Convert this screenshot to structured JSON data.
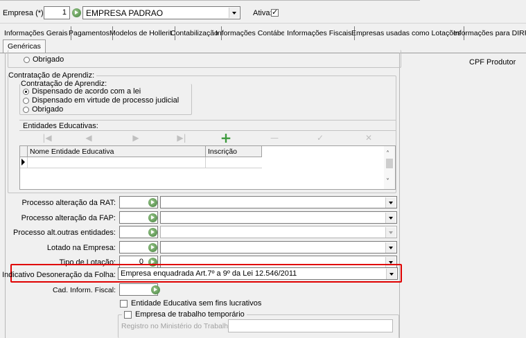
{
  "header": {
    "empresa_label": "Empresa (*):",
    "empresa_code": "1",
    "empresa_name": "EMPRESA PADRAO",
    "ativa_label": "Ativa:"
  },
  "tabs": [
    "Informações Gerais",
    "Pagamentos",
    "Modelos de Hollerit",
    "Contabilização",
    "Informações Contábeis",
    "Informações Fiscais",
    "Empresas usadas como Lotações",
    "Informações para DIRF"
  ],
  "subtab": "Genéricas",
  "cpf_produtor_label": "CPF Produtor",
  "top_partial_radio": "Obrigado",
  "aprendiz": {
    "group_title": "Contratação de Aprendiz:",
    "inner_title": "Contratação de Aprendiz:",
    "options": [
      "Dispensado de acordo com a lei",
      "Dispensado em virtude de processo judicial",
      "Obrigado"
    ]
  },
  "entidades": {
    "title": "Entidades Educativas:",
    "columns": [
      "Nome Entidade Educativa",
      "Inscrição"
    ]
  },
  "form": {
    "rat_label": "Processo alteração da RAT:",
    "fap_label": "Processo alteração da FAP:",
    "outras_label": "Processo alt.outras entidades:",
    "lotado_label": "Lotado na Empresa:",
    "tipo_lotacao_label": "Tipo de Lotação:",
    "tipo_lotacao_value": "0",
    "desoneracao_label": "Indicativo Desoneração da Folha:",
    "desoneracao_value": "Empresa enquadrada Art.7º a 9º da Lei 12.546/2011",
    "cad_fiscal_label": "Cad. Inform. Fiscal:",
    "entidade_sem_fins_label": "Entidade Educativa sem fins lucrativos",
    "empresa_temporario_label": "Empresa de trabalho temporário",
    "registro_label": "Registro no Ministério do Trabalho:"
  },
  "colors": {
    "highlight": "#e00000",
    "add_icon": "#3c9a3c"
  }
}
